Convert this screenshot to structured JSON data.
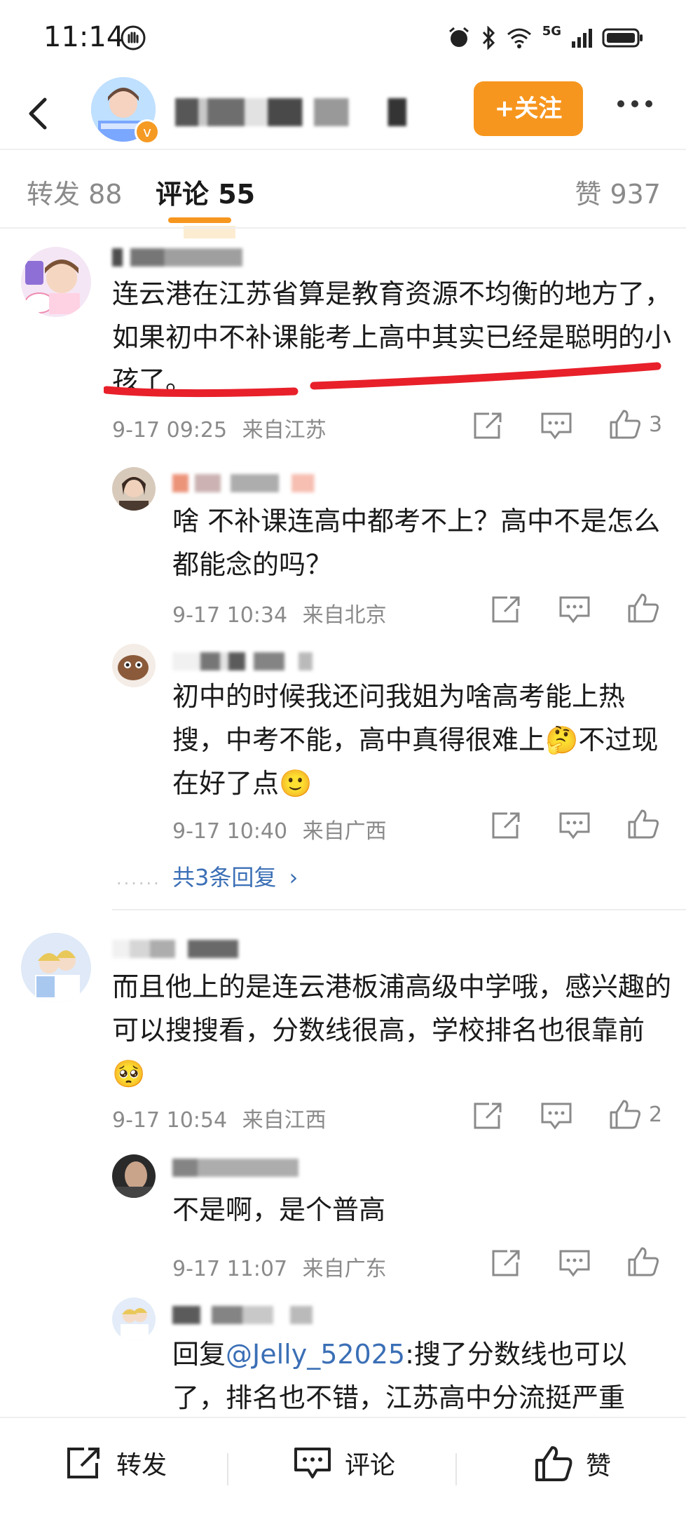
{
  "status_bar": {
    "time": "11:14",
    "network": "5G"
  },
  "header": {
    "follow_label": "+关注",
    "verified_badge": "v"
  },
  "tabs": {
    "repost": "转发 88",
    "comments": "评论 55",
    "likes": "赞 937"
  },
  "comments": [
    {
      "username": "vjas_",
      "text": "连云港在江苏省算是教育资源不均衡的地方了，如果初中不补课能考上高中其实已经是聪明的小孩了。",
      "time": "9-17 09:25",
      "location": "来自江苏",
      "likes": "3",
      "replies": [
        {
          "text": "啥 不补课连高中都考不上？高中不是怎么都能念的吗？",
          "time": "9-17 10:34",
          "location": "来自北京"
        },
        {
          "text": "初中的时候我还问我姐为啥高考能上热搜，中考不能，高中真得很难上🤔不过现在好了点🙂",
          "time": "9-17 10:40",
          "location": "来自广西"
        }
      ],
      "more_replies": "共3条回复"
    },
    {
      "text": "而且他上的是连云港板浦高级中学哦，感兴趣的可以搜搜看，分数线很高，学校排名也很靠前🥺",
      "time": "9-17 10:54",
      "location": "来自江西",
      "likes": "2",
      "replies": [
        {
          "username": "Jelly_52025",
          "text": "不是啊，是个普高",
          "time": "9-17 11:07",
          "location": "来自广东"
        },
        {
          "reply_prefix": "回复",
          "mention": "@Jelly_52025",
          "text": ":搜了分数线也可以了，排名也不错，江苏高中分流挺严重"
        }
      ]
    }
  ],
  "bottom_bar": {
    "repost": "转发",
    "comment": "评论",
    "like": "赞"
  },
  "colors": {
    "accent": "#f7961e",
    "link": "#3b6fb6",
    "muted": "#8a8a8a",
    "annotation": "#e8202a"
  }
}
